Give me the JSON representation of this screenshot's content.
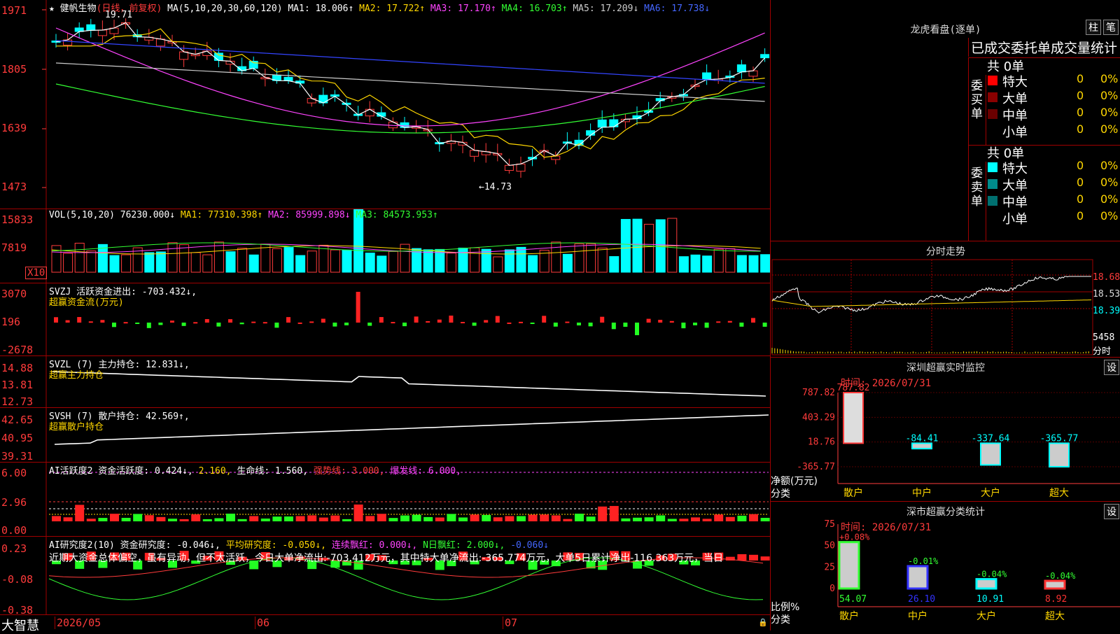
{
  "app": {
    "name": "大智慧"
  },
  "stock": {
    "name": "健帆生物",
    "period": "(日线，前复权)"
  },
  "ma_header": {
    "label": "MA(5,10,20,30,60,120)",
    "items": [
      {
        "label": "MA1: 18.006↑",
        "color": "#ffffff"
      },
      {
        "label": "MA2: 17.722↑",
        "color": "#ffd700"
      },
      {
        "label": "MA3: 17.170↑",
        "color": "#ff44ff"
      },
      {
        "label": "MA4: 16.703↑",
        "color": "#33ff33"
      },
      {
        "label": "MA5: 17.209↓",
        "color": "#cccccc"
      },
      {
        "label": "MA6: 17.738↓",
        "color": "#4466ff"
      }
    ]
  },
  "price_axis": [
    "1971",
    "1805",
    "1639",
    "1473"
  ],
  "price_annotations": {
    "high": "19.71",
    "low": "←14.73"
  },
  "vol": {
    "header": "VOL(5,10,20)",
    "value": "76230.000↓",
    "items": [
      {
        "label": "MA1: 77310.398↑",
        "color": "#ffd700"
      },
      {
        "label": "MA2: 85999.898↓",
        "color": "#ff44ff"
      },
      {
        "label": "MA3: 84573.953↑",
        "color": "#33ff33"
      }
    ],
    "axis": [
      "15833",
      "7819"
    ],
    "unit": "X10"
  },
  "svzj": {
    "header": "SVZJ  活跃资金进出: -703.432↓,",
    "sub": "超赢资金流(万元)",
    "axis": [
      "3070",
      "196",
      "-2678"
    ]
  },
  "svzl": {
    "header": "SVZL (7) 主力持仓: 12.831↓,",
    "sub": "超赢主力持仓",
    "axis": [
      "14.88",
      "13.81",
      "12.73"
    ]
  },
  "svsh": {
    "header": "SVSH (7) 散户持仓: 42.569↑,",
    "sub": "超赢散户持仓",
    "axis": [
      "42.65",
      "40.95",
      "39.31"
    ]
  },
  "ai1": {
    "header": "AI活跃度2 资金活跃度: 0.424↓,",
    "items": [
      {
        "label": "2.160,",
        "color": "#ffd700"
      },
      {
        "label": "生命线: 1.560,",
        "color": "#ffffff"
      },
      {
        "label": "强势线: 3.000,",
        "color": "#ff3b3b"
      },
      {
        "label": "爆发线: 6.000,",
        "color": "#ff44ff"
      }
    ],
    "axis": [
      "6.00",
      "2.96",
      "0.00"
    ]
  },
  "ai2": {
    "header": "AI研究度2(10) 资金研究度: -0.046↓,",
    "items": [
      {
        "label": "平均研究度: -0.050↓,",
        "color": "#ffd700"
      },
      {
        "label": "连续飘红: 0.000↓,",
        "color": "#ff44ff"
      },
      {
        "label": "N日飘红: 2.000↓,",
        "color": "#33ff33"
      },
      {
        "label": "-0.060↓",
        "color": "#4466ff"
      }
    ],
    "comment": "近期大资金总体偏空，虽有异动，但不太活跃，今日大单净流出:-703.412万元，其中特大单净流出:-365.774万元，大单5日累计净出-116.363万元，当日",
    "axis": [
      "0.23",
      "-0.08",
      "-0.38"
    ]
  },
  "date_axis": [
    "2026/05",
    "06",
    "07"
  ],
  "lhb": {
    "title": "龙虎看盘(逐单)",
    "btn_bar": "柱",
    "btn_pen": "笔",
    "tabs": "已成交委托单成交量统计",
    "buy_label": "委买单",
    "sell_label": "委卖单",
    "buy_total": "共 0单",
    "sell_total": "共 0单",
    "buy_rows": [
      {
        "name": "特大",
        "count": "0",
        "pct": "0%",
        "color": "#ff0000"
      },
      {
        "name": "大单",
        "count": "0",
        "pct": "0%",
        "color": "#8b0000"
      },
      {
        "name": "中单",
        "count": "0",
        "pct": "0%",
        "color": "#6b0000"
      },
      {
        "name": "小单",
        "count": "0",
        "pct": "0%",
        "color": "#000000"
      }
    ],
    "sell_rows": [
      {
        "name": "特大",
        "count": "0",
        "pct": "0%",
        "color": "#00ffff"
      },
      {
        "name": "大单",
        "count": "0",
        "pct": "0%",
        "color": "#008b8b"
      },
      {
        "name": "中单",
        "count": "0",
        "pct": "0%",
        "color": "#007070"
      },
      {
        "name": "小单",
        "count": "0",
        "pct": "0%",
        "color": "#000000"
      }
    ]
  },
  "intraday": {
    "title": "分时走势",
    "axis": [
      "18.68",
      "18.53",
      "18.39"
    ],
    "vol": "5458",
    "unit": "分时"
  },
  "monitor": {
    "title": "深圳超赢实时监控",
    "btn": "设",
    "time": "时间: 2026/07/31",
    "axis": [
      "787.82",
      "403.29",
      "18.76",
      "-365.77"
    ],
    "ylabel": "净额(万元)",
    "xlabel": "分类",
    "bars": [
      {
        "name": "散户",
        "value": 787.82,
        "label": "787.82"
      },
      {
        "name": "中户",
        "value": -84.41,
        "label": "-84.41"
      },
      {
        "name": "大户",
        "value": -337.64,
        "label": "-337.64"
      },
      {
        "name": "超大",
        "value": -365.77,
        "label": "-365.77"
      }
    ]
  },
  "classify": {
    "title": "深市超赢分类统计",
    "btn": "设",
    "time": "时间: 2026/07/31",
    "axis": [
      "75",
      "50",
      "25",
      "0"
    ],
    "ylabel": "比例%",
    "xlabel": "分类",
    "bars": [
      {
        "name": "散户",
        "value": 54.07,
        "label": "54.07",
        "delta": "+0.08%",
        "color": "#33ff33"
      },
      {
        "name": "中户",
        "value": 26.1,
        "label": "26.10",
        "delta": "-0.01%",
        "color": "#3333ff"
      },
      {
        "name": "大户",
        "value": 10.91,
        "label": "10.91",
        "delta": "-0.04%",
        "color": "#00ffff"
      },
      {
        "name": "超大",
        "value": 8.92,
        "label": "8.92",
        "delta": "-0.04%",
        "color": "#ff3333"
      }
    ]
  }
}
